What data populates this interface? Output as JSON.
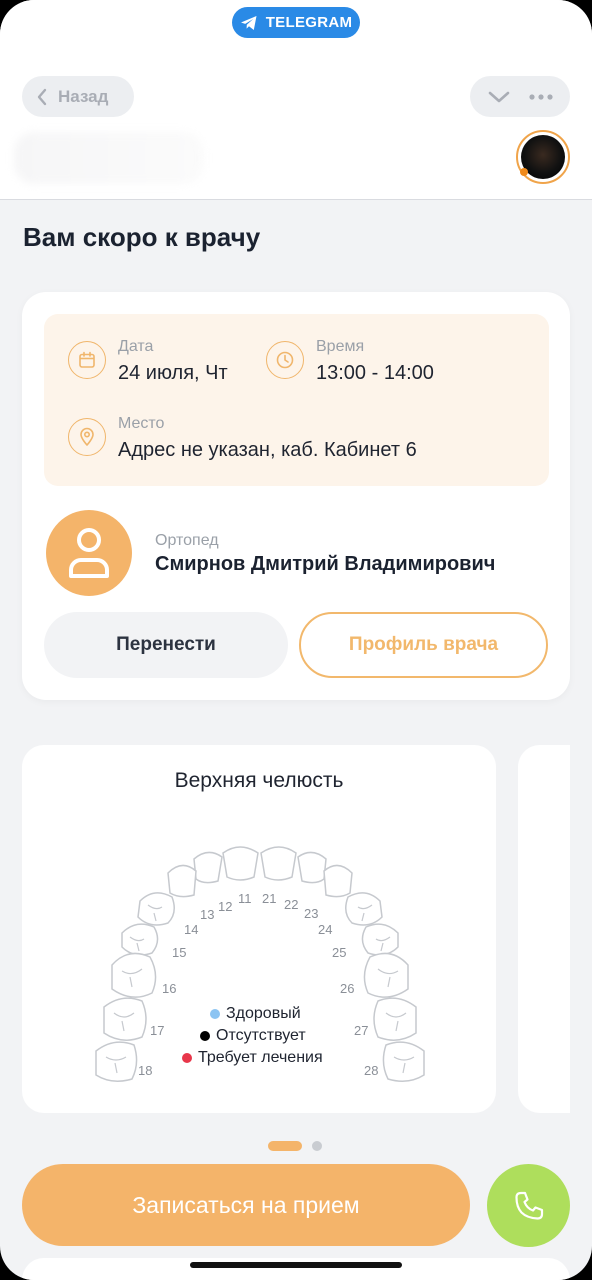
{
  "telegram": {
    "badge": "TELEGRAM"
  },
  "header": {
    "back_label": "Назад",
    "icons": [
      "chevron-down-icon",
      "more-icon"
    ]
  },
  "page": {
    "title": "Вам скоро к врачу"
  },
  "appointment": {
    "date_label": "Дата",
    "date_value": "24 июля, Чт",
    "time_label": "Время",
    "time_value": "13:00 - 14:00",
    "place_label": "Место",
    "place_value": "Адрес не указан, каб. Кабинет 6"
  },
  "doctor": {
    "role": "Ортопед",
    "name": "Смирнов Дмитрий Владимирович"
  },
  "buttons": {
    "reschedule": "Перенести",
    "profile": "Профиль врача",
    "book": "Записаться на прием"
  },
  "jaw": {
    "title": "Верхняя челюсть",
    "tooth_numbers_left": [
      "11",
      "12",
      "13",
      "14",
      "15",
      "16",
      "17",
      "18"
    ],
    "tooth_numbers_right": [
      "21",
      "22",
      "23",
      "24",
      "25",
      "26",
      "27",
      "28"
    ],
    "legend": [
      {
        "label": "Здоровый",
        "color": "#8cc4f2"
      },
      {
        "label": "Отсутствует",
        "color": "#000000"
      },
      {
        "label": "Требует лечения",
        "color": "#e8364a"
      }
    ]
  },
  "carousel": {
    "pages": 2,
    "active": 1
  },
  "colors": {
    "accent": "#f4b46a",
    "accent_light": "#fdf4ea",
    "telegram_blue": "#2a8ae6",
    "call_green": "#aede5c"
  }
}
